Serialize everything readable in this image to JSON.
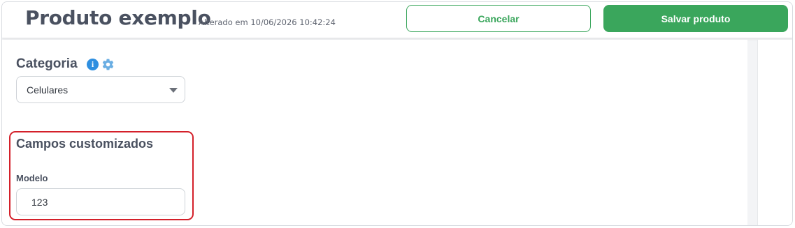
{
  "header": {
    "title": "Produto exemplo",
    "subtitle": "Alterado em 10/06/2026 10:42:24",
    "cancel_label": "Cancelar",
    "save_label": "Salvar produto"
  },
  "category": {
    "label": "Categoria",
    "info_icon": "info-icon",
    "settings_icon": "gear-icon",
    "info_glyph": "i",
    "selected": "Celulares"
  },
  "custom_fields": {
    "title": "Campos customizados",
    "fields": [
      {
        "label": "Modelo",
        "value": "123"
      }
    ]
  },
  "colors": {
    "accent_green": "#3aa65c",
    "highlight_red": "#d4202a",
    "info_blue": "#2f8fe0",
    "gear_blue": "#6aaee3"
  }
}
